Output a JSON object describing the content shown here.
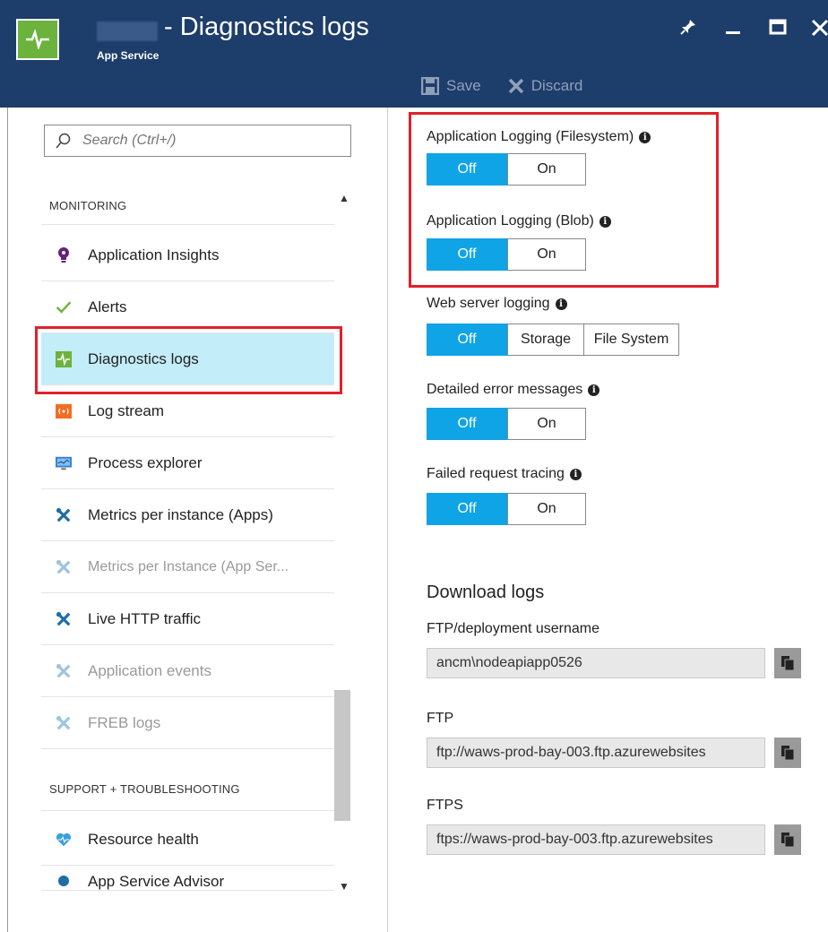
{
  "header": {
    "title": "- Diagnostics logs",
    "subtitle": "App Service"
  },
  "toolbar": {
    "save_label": "Save",
    "discard_label": "Discard"
  },
  "search": {
    "placeholder": "Search (Ctrl+/)"
  },
  "sidebar": {
    "monitoring_heading": "MONITORING",
    "support_heading": "SUPPORT + TROUBLESHOOTING",
    "items": [
      {
        "label": "Application Insights"
      },
      {
        "label": "Alerts"
      },
      {
        "label": "Diagnostics logs"
      },
      {
        "label": "Log stream"
      },
      {
        "label": "Process explorer"
      },
      {
        "label": "Metrics per instance (Apps)"
      },
      {
        "label": "Metrics per Instance (App Ser..."
      },
      {
        "label": "Live HTTP traffic"
      },
      {
        "label": "Application events"
      },
      {
        "label": "FREB logs"
      },
      {
        "label": "Resource health"
      },
      {
        "label": "App Service Advisor"
      }
    ]
  },
  "settings": {
    "app_log_fs": {
      "label": "Application Logging (Filesystem)",
      "off": "Off",
      "on": "On"
    },
    "app_log_blob": {
      "label": "Application Logging (Blob)",
      "off": "Off",
      "on": "On"
    },
    "web_server": {
      "label": "Web server logging",
      "off": "Off",
      "storage": "Storage",
      "filesystem": "File System"
    },
    "detailed_errors": {
      "label": "Detailed error messages",
      "off": "Off",
      "on": "On"
    },
    "failed_request": {
      "label": "Failed request tracing",
      "off": "Off",
      "on": "On"
    }
  },
  "download": {
    "title": "Download logs",
    "ftp_user_label": "FTP/deployment username",
    "ftp_user_value": "ancm\\nodeapiapp0526",
    "ftp_label": "FTP",
    "ftp_value": "ftp://waws-prod-bay-003.ftp.azurewebsites",
    "ftps_label": "FTPS",
    "ftps_value": "ftps://waws-prod-bay-003.ftp.azurewebsites"
  },
  "colors": {
    "header_bg": "#1d3d6b",
    "toggle_active": "#0fa4e6",
    "selected_item": "#c3edf9",
    "highlight": "#e0212b"
  }
}
